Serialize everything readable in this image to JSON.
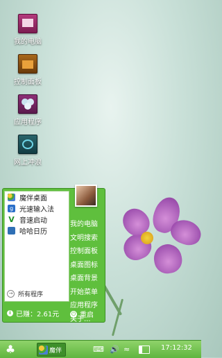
{
  "desktop": {
    "icons": [
      {
        "label": "我的电脑",
        "icon": "computer-icon"
      },
      {
        "label": "控制面板",
        "icon": "control-panel-icon"
      },
      {
        "label": "应用程序",
        "icon": "apps-icon"
      },
      {
        "label": "网上冲浪",
        "icon": "web-icon"
      }
    ]
  },
  "start_menu": {
    "left_items": [
      {
        "label": "魔伴桌面",
        "icon": "desktop-app-icon"
      },
      {
        "label": "光速输入法",
        "icon": "input-method-icon"
      },
      {
        "label": "音速启动",
        "icon": "launcher-icon"
      },
      {
        "label": "哈哈日历",
        "icon": "calendar-icon"
      }
    ],
    "all_programs": "所有程序",
    "right_items": [
      "我的电脑",
      "文明搜索",
      "控制面板",
      "桌面图标",
      "桌面背景",
      "开始菜单",
      "应用程序",
      "关于..."
    ],
    "earned": "已赚：2.61元",
    "restart": "重启"
  },
  "taskbar": {
    "start_icon": "clover-icon",
    "app_label": "魔伴",
    "clock": "17:12:32"
  },
  "colors": {
    "menu_green": "#5fbf3d",
    "taskbar_green": "#6fbf4a"
  }
}
